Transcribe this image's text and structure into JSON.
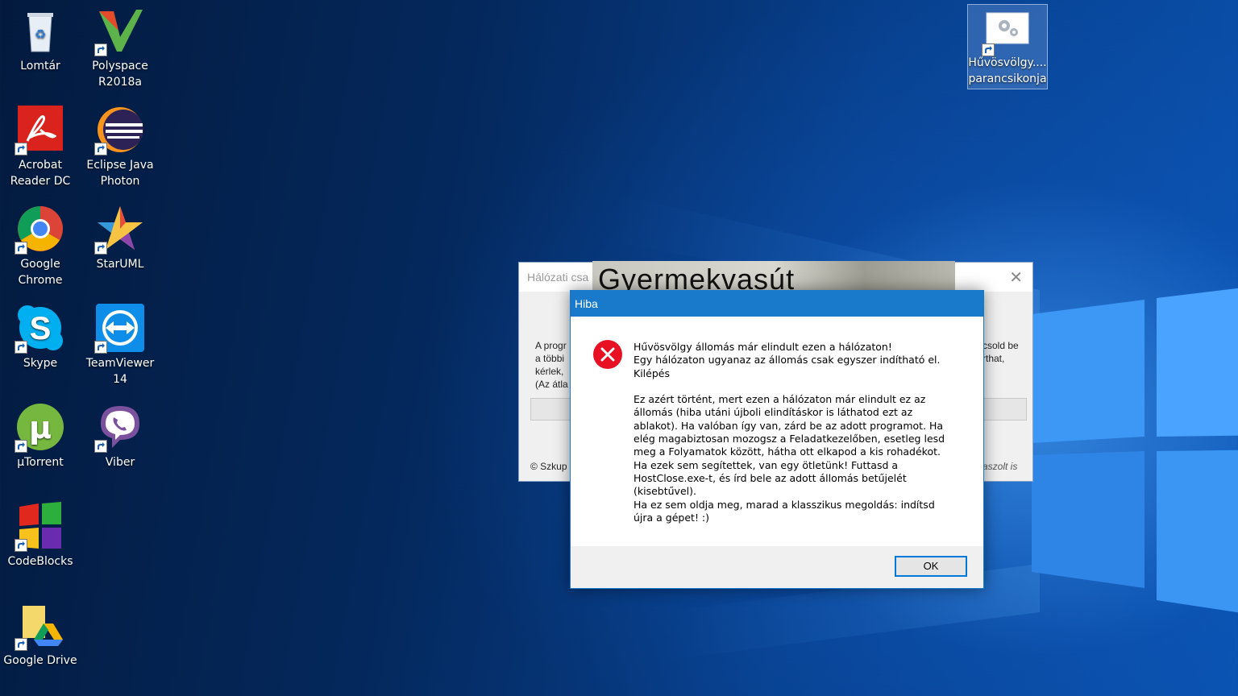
{
  "desktop": {
    "icons": [
      {
        "label": "Lomtár",
        "icon": "recycle-bin-icon"
      },
      {
        "label": "Polyspace R2018a",
        "icon": "polyspace-icon"
      },
      {
        "label": "Acrobat Reader DC",
        "icon": "acrobat-icon"
      },
      {
        "label": "Eclipse Java Photon",
        "icon": "eclipse-icon"
      },
      {
        "label": "Google Chrome",
        "icon": "chrome-icon"
      },
      {
        "label": "StarUML",
        "icon": "staruml-icon"
      },
      {
        "label": "Skype",
        "icon": "skype-icon"
      },
      {
        "label": "TeamViewer 14",
        "icon": "teamviewer-icon"
      },
      {
        "label": "µTorrent",
        "icon": "utorrent-icon"
      },
      {
        "label": "Viber",
        "icon": "viber-icon"
      },
      {
        "label": "CodeBlocks",
        "icon": "codeblocks-icon"
      },
      {
        "label": "Google Drive",
        "icon": "google-drive-icon"
      },
      {
        "label": "Hűvösvölgy.... parancsikonja",
        "icon": "settings-shortcut-icon"
      }
    ]
  },
  "background_window": {
    "title": "Hálózati csa",
    "photo_text": "Gyermekvasút",
    "left_text": "A progr\na többi\nkérlek,\n(Az átla",
    "right_text": "csold be\nrthat,",
    "footer_left": "© Szkup",
    "footer_right": "aszolt is"
  },
  "error_dialog": {
    "title": "Hiba",
    "message": "Hűvösvölgy állomás már elindult ezen a hálózaton!\nEgy hálózaton ugyanaz az állomás csak egyszer indítható el.\nKilépés\n\nEz azért történt, mert ezen a hálózaton már elindult ez az\nállomás (hiba utáni újboli elindításkor is láthatod ezt az\nablakot). Ha valóban így van, zárd be az adott programot. Ha\nelég magabiztosan mozogsz a Feladatkezelőben, esetleg lesd\nmeg a Folyamatok között, hátha ott elkapod a kis rohadékot.\nHa ezek sem segítettek, van egy ötletünk! Futtasd a\nHostClose.exe-t, és írd bele az adott állomás betűjelét\n(kisebtűvel).\nHa ez sem oldja meg, marad a klasszikus megoldás: indítsd\nújra a gépet! :)",
    "ok_label": "OK"
  },
  "colors": {
    "title_bar": "#1979ca",
    "accent": "#0078d7",
    "error_icon": "#e81123"
  }
}
